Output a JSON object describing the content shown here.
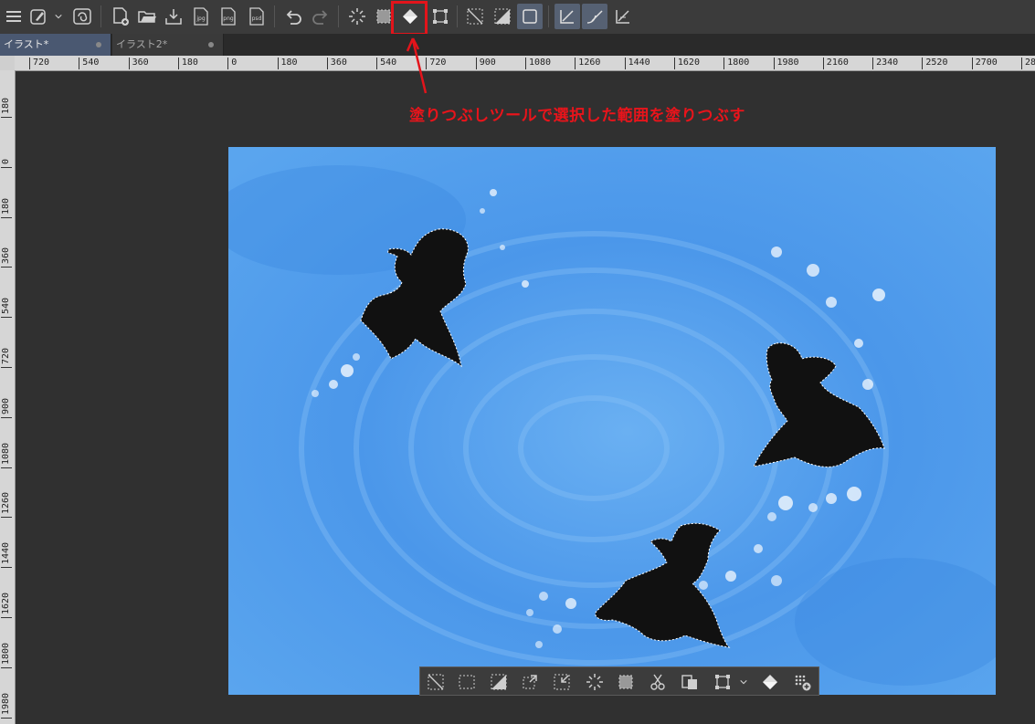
{
  "tabs": [
    {
      "label": "イラスト*"
    },
    {
      "label": "イラスト2*"
    }
  ],
  "ruler_h": [
    "720",
    "540",
    "360",
    "180",
    "0",
    "180",
    "360",
    "540",
    "720",
    "900",
    "1080",
    "1260",
    "1440",
    "1620",
    "1800",
    "1980",
    "2160",
    "2340",
    "2520",
    "2700",
    "28"
  ],
  "ruler_v": [
    "180",
    "0",
    "180",
    "360",
    "540",
    "720",
    "900",
    "1080",
    "1260",
    "1440",
    "1620",
    "1800",
    "1980"
  ],
  "annotation": {
    "text": "塗りつぶしツールで選択した範囲を塗りつぶす"
  },
  "toolbar_icons": {
    "menu": "menu-icon",
    "file_format": [
      "jpg",
      "png",
      "psd"
    ]
  },
  "colors": {
    "annotation": "#e8141b",
    "canvas_bg": "#303030",
    "artwork_blue": "#4a97ea",
    "selection_fill": "#111111"
  }
}
